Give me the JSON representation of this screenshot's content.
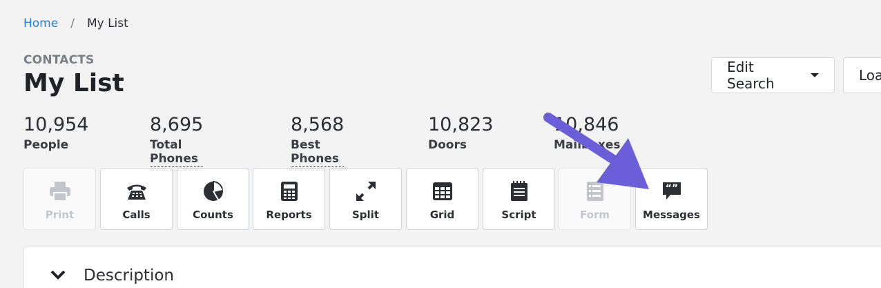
{
  "breadcrumb": {
    "home": "Home",
    "separator": "/",
    "current": "My List"
  },
  "header": {
    "section": "CONTACTS",
    "title": "My List"
  },
  "actions": {
    "edit_search": "Edit Search",
    "load": "Loa"
  },
  "stats": [
    {
      "value": "10,954",
      "label": "People"
    },
    {
      "value": "8,695",
      "label": "Total Phones"
    },
    {
      "value": "8,568",
      "label": "Best Phones"
    },
    {
      "value": "10,823",
      "label": "Doors"
    },
    {
      "value": "10,846",
      "label": "Mailboxes"
    }
  ],
  "toolbar": [
    {
      "label": "Print",
      "icon": "printer-icon",
      "enabled": false
    },
    {
      "label": "Calls",
      "icon": "phone-icon",
      "enabled": true
    },
    {
      "label": "Counts",
      "icon": "pie-chart-icon",
      "enabled": true
    },
    {
      "label": "Reports",
      "icon": "calculator-icon",
      "enabled": true
    },
    {
      "label": "Split",
      "icon": "expand-arrows-icon",
      "enabled": true
    },
    {
      "label": "Grid",
      "icon": "table-icon",
      "enabled": true
    },
    {
      "label": "Script",
      "icon": "notepad-icon",
      "enabled": true
    },
    {
      "label": "Form",
      "icon": "form-icon",
      "enabled": false
    },
    {
      "label": "Messages",
      "icon": "speech-bubble-quote-icon",
      "enabled": true
    }
  ],
  "description": {
    "title": "Description",
    "icon": "chevron-down-icon"
  },
  "colors": {
    "link": "#2a7fd4",
    "annotation_arrow": "#6a5fd8"
  }
}
